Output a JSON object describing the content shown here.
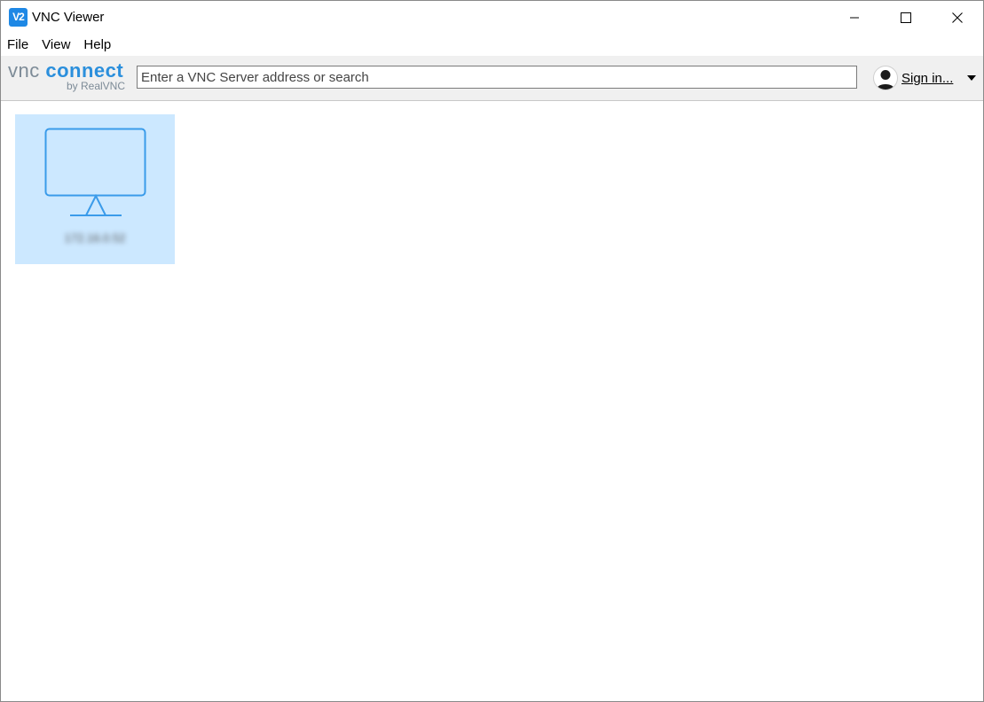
{
  "window": {
    "title": "VNC Viewer",
    "app_icon_text": "V2",
    "controls": {
      "minimize": "minimize-icon",
      "maximize": "maximize-icon",
      "close": "close-icon"
    }
  },
  "menu": {
    "items": [
      {
        "label": "File"
      },
      {
        "label": "View"
      },
      {
        "label": "Help"
      }
    ]
  },
  "toolbar": {
    "logo": {
      "vnc": "vnc",
      "connect": "connect",
      "byline": "by RealVNC"
    },
    "search": {
      "placeholder": "Enter a VNC Server address or search",
      "value": ""
    },
    "signin": {
      "label": "Sign in...",
      "icon": "user-avatar-icon",
      "caret": "chevron-down-icon"
    }
  },
  "address_book": {
    "entries": [
      {
        "label": "172.16.0.52",
        "icon": "monitor-icon",
        "selected": true
      }
    ]
  },
  "colors": {
    "accent": "#2b8fdc",
    "tile_selected": "#cce8ff",
    "toolbar_bg": "#f0f0f0"
  }
}
